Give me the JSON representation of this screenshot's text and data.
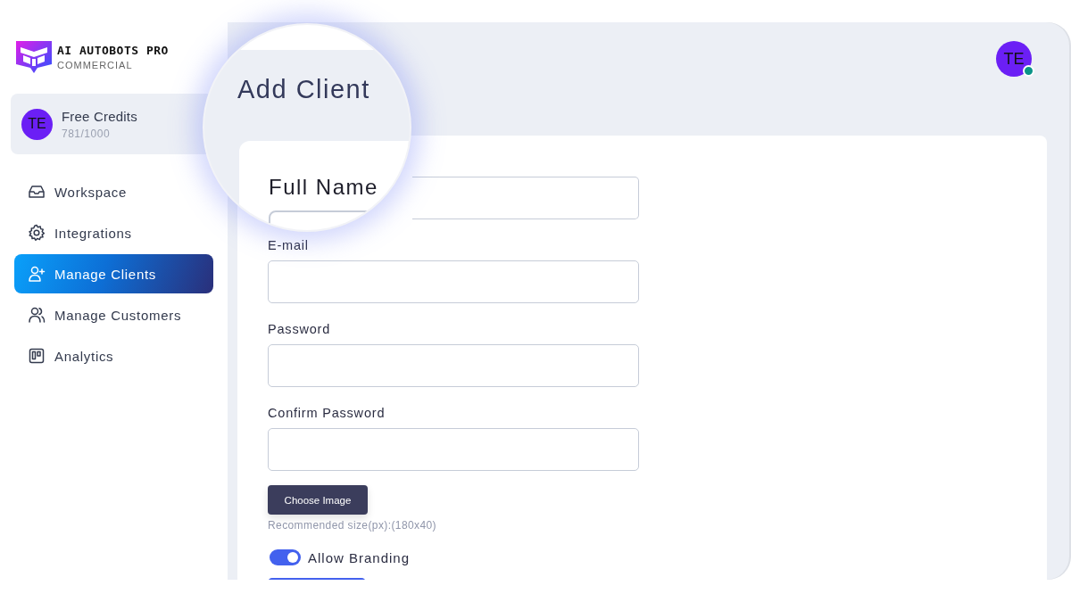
{
  "brand": {
    "name": "AI AUTOBOTS PRO",
    "edition": "COMMERCIAL"
  },
  "credits": {
    "avatar": "TE",
    "title": "Free Credits",
    "usage": "781/1000"
  },
  "nav": [
    {
      "label": "Workspace",
      "kind": "inbox",
      "selected": false
    },
    {
      "label": "Integrations",
      "kind": "gear",
      "selected": false
    },
    {
      "label": "Manage Clients",
      "kind": "user-plus",
      "selected": true
    },
    {
      "label": "Manage Customers",
      "kind": "users",
      "selected": false
    },
    {
      "label": "Analytics",
      "kind": "board",
      "selected": false
    }
  ],
  "user_avatar": {
    "initials": "TE",
    "online": true
  },
  "page_title": "Add Client",
  "form": {
    "fields": [
      {
        "label": "Full Name"
      },
      {
        "label": "E-mail"
      },
      {
        "label": "Password"
      },
      {
        "label": "Confirm Password"
      }
    ],
    "upload": {
      "button": "Choose Image",
      "hint": "Recommended size(px):(180x40)"
    },
    "branding": {
      "label": "Allow Branding",
      "on": true
    }
  }
}
